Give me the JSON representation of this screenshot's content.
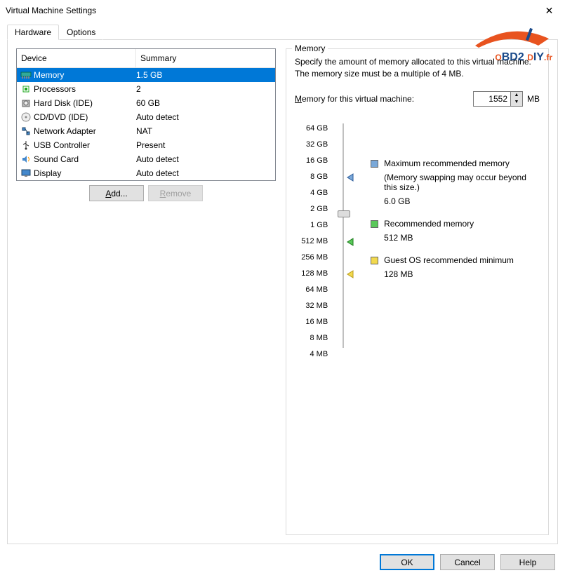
{
  "window": {
    "title": "Virtual Machine Settings"
  },
  "tabs": {
    "hardware": "Hardware",
    "options": "Options"
  },
  "list": {
    "col_device": "Device",
    "col_summary": "Summary",
    "rows": [
      {
        "name": "Memory",
        "summary": "1.5 GB"
      },
      {
        "name": "Processors",
        "summary": "2"
      },
      {
        "name": "Hard Disk (IDE)",
        "summary": "60 GB"
      },
      {
        "name": "CD/DVD (IDE)",
        "summary": "Auto detect"
      },
      {
        "name": "Network Adapter",
        "summary": "NAT"
      },
      {
        "name": "USB Controller",
        "summary": "Present"
      },
      {
        "name": "Sound Card",
        "summary": "Auto detect"
      },
      {
        "name": "Display",
        "summary": "Auto detect"
      }
    ]
  },
  "buttons": {
    "add": "Add...",
    "remove": "Remove",
    "ok": "OK",
    "cancel": "Cancel",
    "help": "Help"
  },
  "memory": {
    "group": "Memory",
    "desc": "Specify the amount of memory allocated to this virtual machine. The memory size must be a multiple of 4 MB.",
    "label": "Memory for this virtual machine:",
    "value": "1552",
    "unit": "MB",
    "ticks": [
      "64 GB",
      "32 GB",
      "16 GB",
      "8 GB",
      "4 GB",
      "2 GB",
      "1 GB",
      "512 MB",
      "256 MB",
      "128 MB",
      "64 MB",
      "32 MB",
      "16 MB",
      "8 MB",
      "4 MB"
    ],
    "legend": {
      "max": {
        "title": "Maximum recommended memory",
        "note": "(Memory swapping may occur beyond this size.)",
        "value": "6.0 GB"
      },
      "rec": {
        "title": "Recommended memory",
        "value": "512 MB"
      },
      "min": {
        "title": "Guest OS recommended minimum",
        "value": "128 MB"
      }
    }
  },
  "watermark": {
    "text": "OBD2 DIY.fr"
  }
}
